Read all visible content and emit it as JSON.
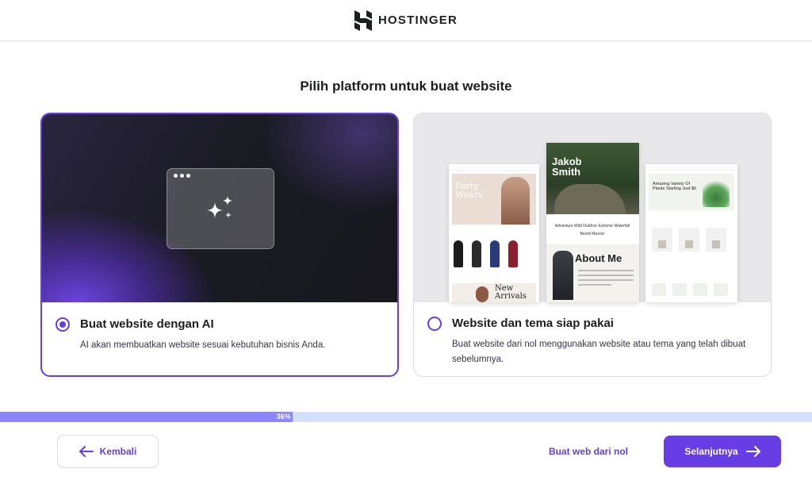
{
  "header": {
    "brand": "HOSTINGER",
    "logo_icon": "hostinger-logo-icon"
  },
  "page": {
    "title": "Pilih platform untuk buat website"
  },
  "options": [
    {
      "title": "Buat website dengan AI",
      "description": "AI akan membuatkan website sesuai kebutuhan bisnis Anda.",
      "selected": true,
      "icon": "sparkle-icon"
    },
    {
      "title": "Website dan tema siap pakai",
      "description": "Buat website dari nol menggunakan website atau tema yang telah dibuat sebelumnya.",
      "selected": false,
      "previews": {
        "fashion_headline": "Party Wears",
        "fashion_arrivals": "New Arrivals",
        "portfolio_name": "Jakob Smith",
        "portfolio_tags": "Adventure Wild Outdoor Extreme Waterfall Beard Muscle",
        "portfolio_about": "About Me",
        "plants_headline": "Amazing Variety Of Plants Starting Just $6"
      }
    }
  ],
  "progress": {
    "value": 36,
    "label": "36%"
  },
  "footer": {
    "back_label": "Kembali",
    "scratch_label": "Buat web dari nol",
    "next_label": "Selanjutnya"
  },
  "colors": {
    "accent": "#673de6",
    "progress_fill": "#8c85ff",
    "progress_track": "#d5dfff"
  }
}
